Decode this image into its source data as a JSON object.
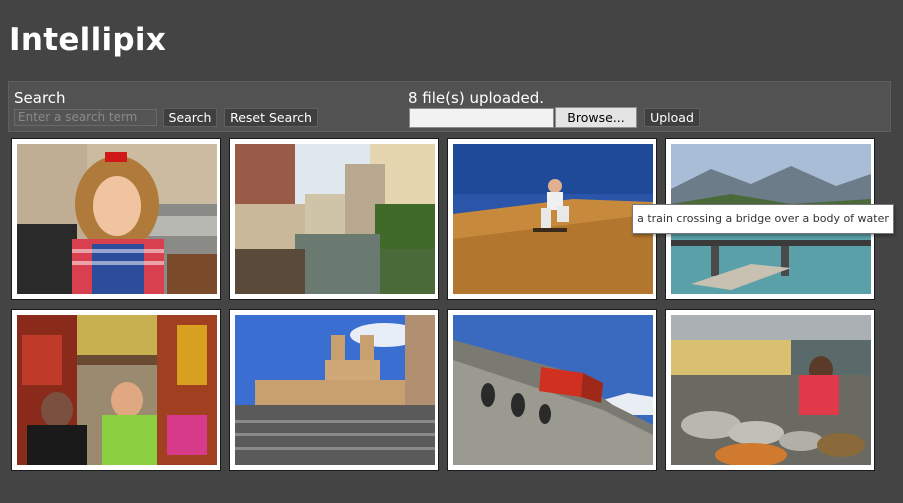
{
  "app": {
    "title": "Intellipix"
  },
  "search": {
    "label": "Search",
    "placeholder": "Enter a search term",
    "search_button": "Search",
    "reset_button": "Reset Search"
  },
  "upload": {
    "status": "8 file(s) uploaded.",
    "browse_button": "Browse...",
    "upload_button": "Upload"
  },
  "gallery": {
    "tooltip": "a train crossing a bridge over a body of water"
  }
}
